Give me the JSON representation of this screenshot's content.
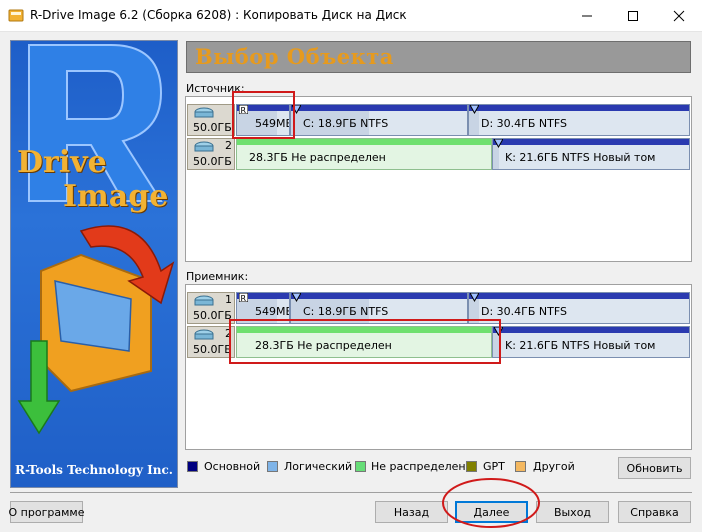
{
  "window": {
    "title": "R-Drive Image 6.2 (Сборка 6208) : Копировать Диск на Диск",
    "controls": {
      "minimize": "—",
      "maximize": "☐",
      "close": "✕"
    }
  },
  "banner": {
    "logo_text_1": "Drive",
    "logo_text_2": "Image",
    "company": "R-Tools Technology Inc."
  },
  "header": {
    "title": "Выбор Объекта"
  },
  "source": {
    "label": "Источник:",
    "disks": [
      {
        "size": "50.0ГБ",
        "number": "",
        "partitions": [
          {
            "label": "549МБ"
          },
          {
            "label": "C:  18.9ГБ  NTFS"
          },
          {
            "label": "D:  30.4ГБ  NTFS"
          }
        ]
      },
      {
        "size": "50.0ГБ",
        "number": "2",
        "partitions": [
          {
            "label": "28.3ГБ  Не распределен"
          },
          {
            "label": "K:  21.6ГБ  NTFS  Новый том"
          }
        ]
      }
    ]
  },
  "target": {
    "label": "Приемник:",
    "disks": [
      {
        "size": "50.0ГБ",
        "number": "1",
        "partitions": [
          {
            "label": "549МБ"
          },
          {
            "label": "C:  18.9ГБ  NTFS"
          },
          {
            "label": "D:  30.4ГБ  NTFS"
          }
        ]
      },
      {
        "size": "50.0ГБ",
        "number": "2",
        "partitions": [
          {
            "label": "28.3ГБ  Не распределен"
          },
          {
            "label": "K:  21.6ГБ  NTFS  Новый том"
          }
        ]
      }
    ]
  },
  "legend": [
    {
      "label": "Основной",
      "color": "#000080"
    },
    {
      "label": "Логический",
      "color": "#7fb4e8"
    },
    {
      "label": "Не распределен",
      "color": "#66dd77"
    },
    {
      "label": "GPT",
      "color": "#808000"
    },
    {
      "label": "Другой",
      "color": "#f4b860"
    }
  ],
  "buttons": {
    "refresh": "Обновить",
    "about": "О программе",
    "back": "Назад",
    "next": "Далее",
    "exit": "Выход",
    "help": "Справка"
  },
  "colors": {
    "header_text": "#e69a1e",
    "primary_bar": "#2a3ab0",
    "unallocated_bar": "#6fe06f",
    "highlight": "#d01a1a"
  }
}
